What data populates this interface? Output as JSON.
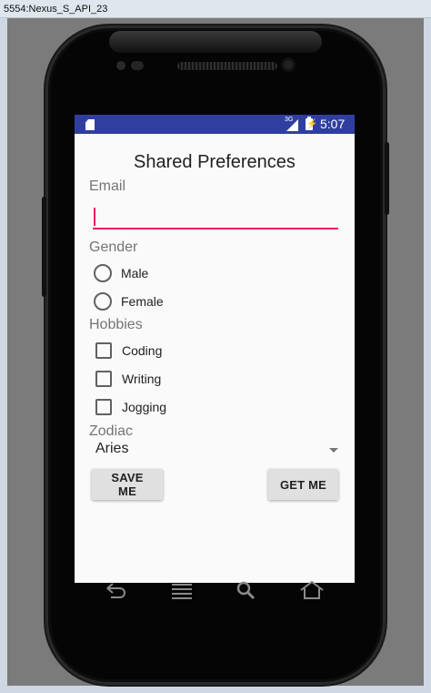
{
  "window": {
    "title": "5554:Nexus_S_API_23"
  },
  "status_bar": {
    "network": "3G",
    "time": "5:07",
    "color": "#303f9f"
  },
  "app": {
    "title": "Shared Preferences",
    "email": {
      "label": "Email",
      "value": "",
      "accent": "#e91e63"
    },
    "gender": {
      "label": "Gender",
      "options": [
        "Male",
        "Female"
      ]
    },
    "hobbies": {
      "label": "Hobbies",
      "options": [
        "Coding",
        "Writing",
        "Jogging"
      ]
    },
    "zodiac": {
      "label": "Zodiac",
      "selected": "Aries"
    },
    "buttons": {
      "save": "SAVE ME",
      "get": "GET ME"
    }
  },
  "nav_icons": [
    "back-icon",
    "menu-icon",
    "search-icon",
    "home-icon"
  ]
}
